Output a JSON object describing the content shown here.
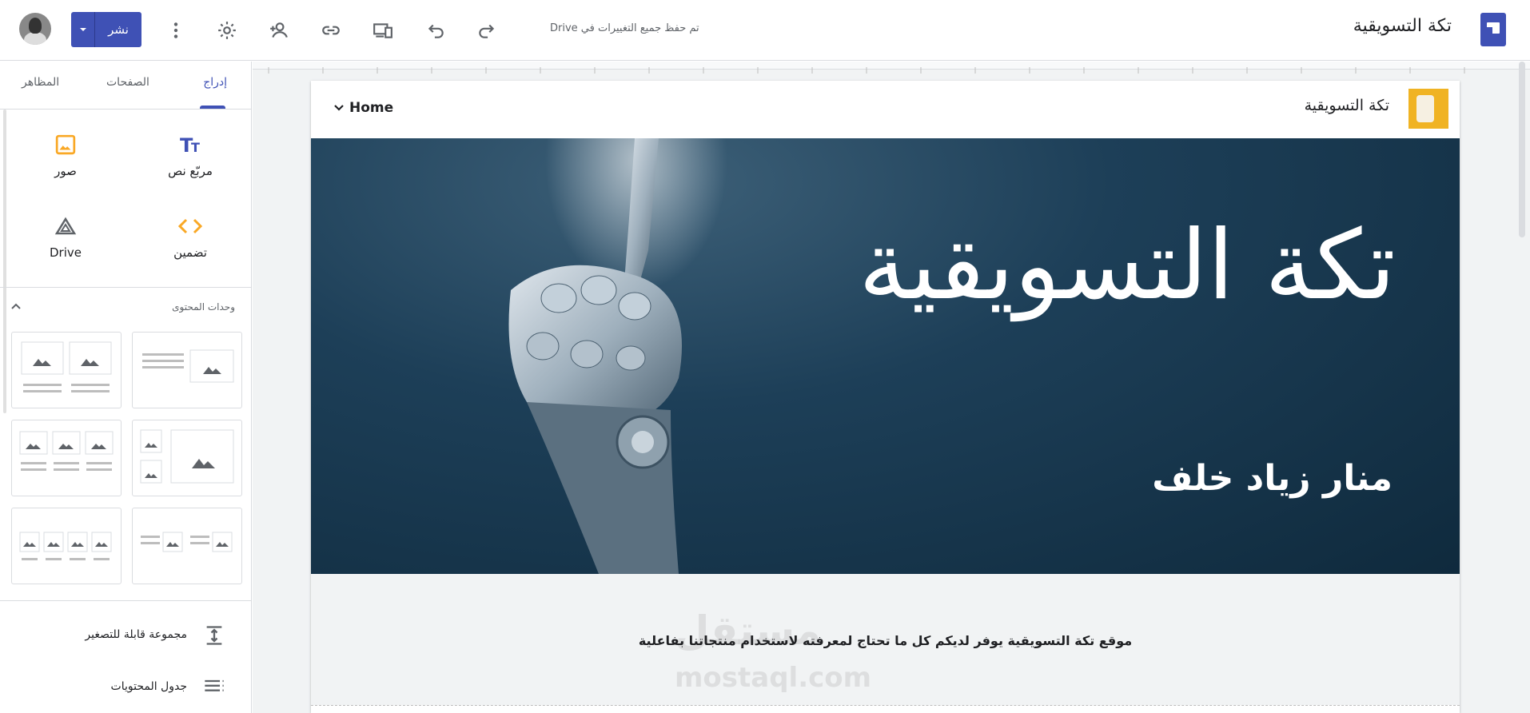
{
  "header": {
    "doc_title": "تكة التسويقية",
    "saved_status": "تم حفظ جميع التغييرات في Drive",
    "publish_label": "نشر",
    "icons": [
      "redo-icon",
      "undo-icon",
      "preview-icon",
      "link-icon",
      "share-icon",
      "settings-icon",
      "more-icon"
    ]
  },
  "sidebar": {
    "tabs": [
      {
        "label": "إدراج",
        "active": true
      },
      {
        "label": "الصفحات",
        "active": false
      },
      {
        "label": "المظاهر",
        "active": false
      }
    ],
    "tools": [
      {
        "label": "مربّع نص",
        "icon": "text-box-icon"
      },
      {
        "label": "صور",
        "icon": "image-icon"
      },
      {
        "label": "تضمين",
        "icon": "embed-icon"
      },
      {
        "label": "Drive",
        "icon": "drive-icon"
      }
    ],
    "section_title": "وحدات المحتوى",
    "bottom_items": [
      {
        "label": "مجموعة قابلة للتصغير",
        "icon": "collapsible-icon"
      },
      {
        "label": "جدول المحتويات",
        "icon": "toc-icon"
      }
    ]
  },
  "site": {
    "name": "تكة التسويقية",
    "nav_home": "Home",
    "hero_title": "تكة التسويقية",
    "hero_subtitle": "منار زياد  خلف",
    "body_text": "موقع تكة التسويقية يوفر لديكم كل ما تحتاج لمعرفته لاستخدام منتجاتنا بفاعلية",
    "watermark": "مستقل",
    "watermark_url": "mostaql.com"
  },
  "colors": {
    "accent": "#3f51b5",
    "hero_bg": "#1d3f58"
  }
}
